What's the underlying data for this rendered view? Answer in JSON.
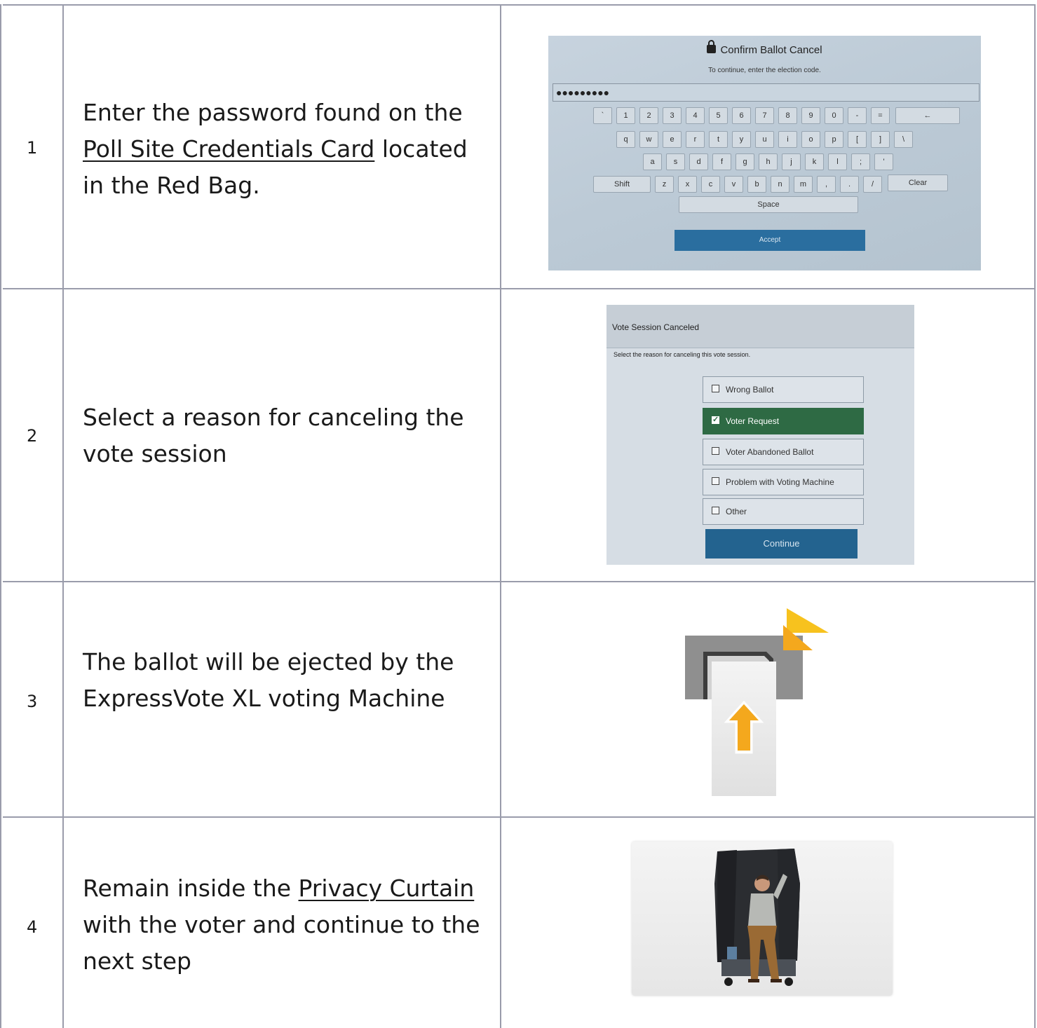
{
  "steps": [
    {
      "number": "1",
      "text_pre": "Enter the password found on the ",
      "link": "Poll Site Credentials Card",
      "text_post": " located in the Red Bag."
    },
    {
      "number": "2",
      "text": "Select a reason for canceling the vote session"
    },
    {
      "number": "3",
      "text": "The ballot will be ejected by the ExpressVote XL voting Machine"
    },
    {
      "number": "4",
      "text_pre": "Remain inside the ",
      "link": "Privacy Curtain",
      "text_post": " with the voter and continue to the next step"
    }
  ],
  "screen1": {
    "title": "Confirm Ballot Cancel",
    "subtitle": "To continue, enter the election code.",
    "password_mask": "●●●●●●●●●",
    "row1": [
      "`",
      "1",
      "2",
      "3",
      "4",
      "5",
      "6",
      "7",
      "8",
      "9",
      "0",
      "-",
      "="
    ],
    "backspace": "←",
    "row2": [
      "q",
      "w",
      "e",
      "r",
      "t",
      "y",
      "u",
      "i",
      "o",
      "p",
      "[",
      "]",
      "\\"
    ],
    "row3": [
      "a",
      "s",
      "d",
      "f",
      "g",
      "h",
      "j",
      "k",
      "l",
      ";",
      "'"
    ],
    "shift": "Shift",
    "row4": [
      "z",
      "x",
      "c",
      "v",
      "b",
      "n",
      "m",
      ",",
      ".",
      "/"
    ],
    "clear": "Clear",
    "space": "Space",
    "accept": "Accept"
  },
  "screen2": {
    "header": "Vote Session Canceled",
    "prompt": "Select the reason for canceling this vote session.",
    "options": [
      "Wrong Ballot",
      "Voter Request",
      "Voter Abandoned Ballot",
      "Problem with Voting Machine",
      "Other"
    ],
    "selected": "Voter Request",
    "continue": "Continue"
  },
  "colors": {
    "grid_line": "#9a9cab",
    "selected_option": "#2e6a44",
    "primary_button": "#23638f",
    "eject_arrow": "#f4a81d"
  },
  "icons": {
    "lock": "lock-icon",
    "eject_arrow": "up-arrow-icon"
  }
}
